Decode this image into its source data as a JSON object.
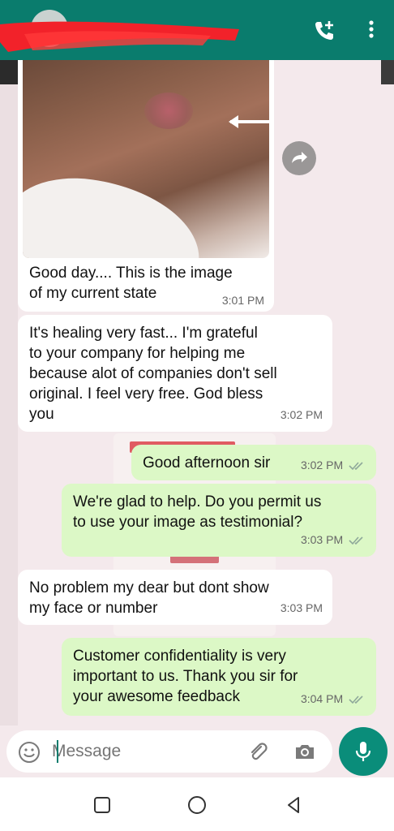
{
  "header": {
    "call_icon": "add-call-icon",
    "menu_icon": "overflow-menu-icon",
    "brand_color": "#0a7c6d"
  },
  "messages": [
    {
      "id": "m1",
      "direction": "in",
      "text_lines": [
        "Good day.... This is the image",
        "of my current state"
      ],
      "time": "3:01 PM",
      "has_image": true
    },
    {
      "id": "m2",
      "direction": "in",
      "text_lines": [
        "It's healing very fast... I'm grateful",
        "to your company for helping me",
        "because alot of companies don't sell",
        "original. I feel very free. God bless",
        "you"
      ],
      "time": "3:02 PM"
    },
    {
      "id": "m3",
      "direction": "out",
      "text_lines": [
        "Good afternoon sir"
      ],
      "time": "3:02 PM",
      "read": true
    },
    {
      "id": "m4",
      "direction": "out",
      "text_lines": [
        "We're glad to help. Do you permit us",
        "to use your image as testimonial?"
      ],
      "time": "3:03 PM",
      "read": true
    },
    {
      "id": "m5",
      "direction": "in",
      "text_lines": [
        "No problem my dear but dont show",
        "my face or number"
      ],
      "time": "3:03 PM"
    },
    {
      "id": "m6",
      "direction": "out",
      "text_lines": [
        "Customer confidentiality is very",
        "important to us. Thank you sir for",
        "your awesome feedback"
      ],
      "time": "3:04 PM",
      "read": true
    }
  ],
  "composer": {
    "placeholder": "Message",
    "emoji_icon": "emoji-icon",
    "attach_icon": "paperclip-icon",
    "camera_icon": "camera-icon",
    "mic_icon": "microphone-icon"
  },
  "colors": {
    "incoming": "#ffffff",
    "outgoing": "#dcf8c6",
    "read_ticks": "#8fa89a",
    "accent": "#0a8d7a"
  }
}
